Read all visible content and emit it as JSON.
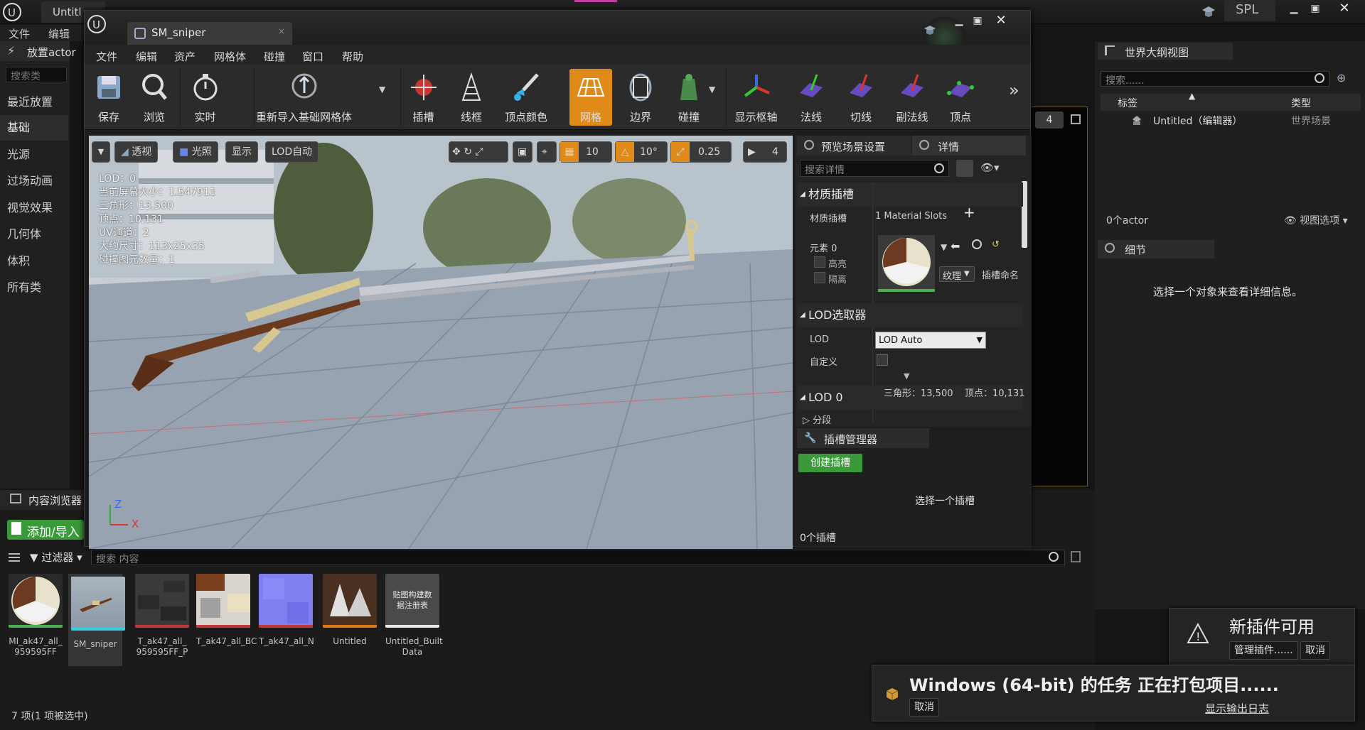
{
  "main": {
    "tab_title": "Untitl",
    "project": "SPL",
    "menu": [
      "文件",
      "编辑"
    ],
    "place_actor": "放置actor",
    "search_placeholder": "搜索类",
    "categories": [
      "最近放置",
      "基础",
      "光源",
      "过场动画",
      "视觉效果",
      "几何体",
      "体积",
      "所有类"
    ],
    "bg_viewport_badge": "4"
  },
  "content_browser": {
    "tab": "内容浏览器",
    "add_import": "添加/导入",
    "filter": "过滤器",
    "search_placeholder": "搜索 内容",
    "status": "7 项(1 项被选中)",
    "assets": [
      {
        "name": "MI_ak47_all_\n959595FF",
        "bar": "#4caf50"
      },
      {
        "name": "SM_sniper",
        "bar": "#35d0e0"
      },
      {
        "name": "T_ak47_all_\n959595FF_P",
        "bar": "#c0383c"
      },
      {
        "name": "T_ak47_all_BC",
        "bar": "#c0383c"
      },
      {
        "name": "T_ak47_all_N",
        "bar": "#c0383c"
      },
      {
        "name": "Untitled",
        "bar": "#e07a10"
      },
      {
        "name": "Untitled_Built\nData",
        "bar": "#e8e8e8",
        "label": "贴图构建数\n据注册表"
      }
    ]
  },
  "outliner": {
    "tab": "世界大纲视图",
    "search_placeholder": "搜索......",
    "col_label": "标签",
    "col_type": "类型",
    "item_name": "Untitled（编辑器）",
    "item_type": "世界场景",
    "actor_count": "0个actor",
    "view_options": "视图选项"
  },
  "details_main": {
    "tab": "细节",
    "hint": "选择一个对象来查看详细信息。"
  },
  "mesh_editor": {
    "tab": "SM_sniper",
    "menu": [
      "文件",
      "编辑",
      "资产",
      "网格体",
      "碰撞",
      "窗口",
      "帮助"
    ],
    "toolbar": [
      "保存",
      "浏览",
      "实时",
      "重新导入基础网格体",
      "插槽",
      "线框",
      "顶点颜色",
      "网格",
      "边界",
      "碰撞",
      "显示枢轴",
      "法线",
      "切线",
      "副法线",
      "顶点"
    ],
    "viewport": {
      "perspective": "透视",
      "lit": "光照",
      "show": "显示",
      "lod": "LOD自动",
      "grid_snap": "10",
      "rot_snap": "10°",
      "scale_snap": "0.25",
      "cam_speed": "4",
      "info": [
        "LOD：0",
        "当前屏幕大小：1.547911",
        "三角形：13,500",
        "顶点：10,131",
        "UV通道：2",
        "大约尺寸：113x25x35",
        "碰撞图元数量：1"
      ],
      "axis_z": "Z",
      "axis_x": "X"
    },
    "panel_tabs": [
      "预览场景设置",
      "详情"
    ],
    "search_details": "搜索详情",
    "material_section": "材质插槽",
    "material_slots_label": "材质插槽",
    "material_slots_value": "1 Material Slots",
    "element": "元素 0",
    "highlight": "高亮",
    "isolate": "隔离",
    "texture_btn": "纹理",
    "slot_name": "插槽命名",
    "lod_picker_section": "LOD选取器",
    "lod_label": "LOD",
    "lod_value": "LOD Auto",
    "custom_label": "自定义",
    "lod0_section": "LOD 0",
    "lod0_stats": "三角形：13,500    顶点：10,131",
    "sections": "分段",
    "socket_manager": "插槽管理器",
    "create_socket": "创建插槽",
    "select_socket": "选择一个插槽",
    "socket_count": "0个插槽"
  },
  "notifications": {
    "plugin_title": "新插件可用",
    "plugin_manage": "管理插件......",
    "plugin_cancel": "取消",
    "package_title": "Windows (64-bit) 的任务 正在打包项目......",
    "package_cancel": "取消",
    "package_log": "显示输出日志"
  }
}
